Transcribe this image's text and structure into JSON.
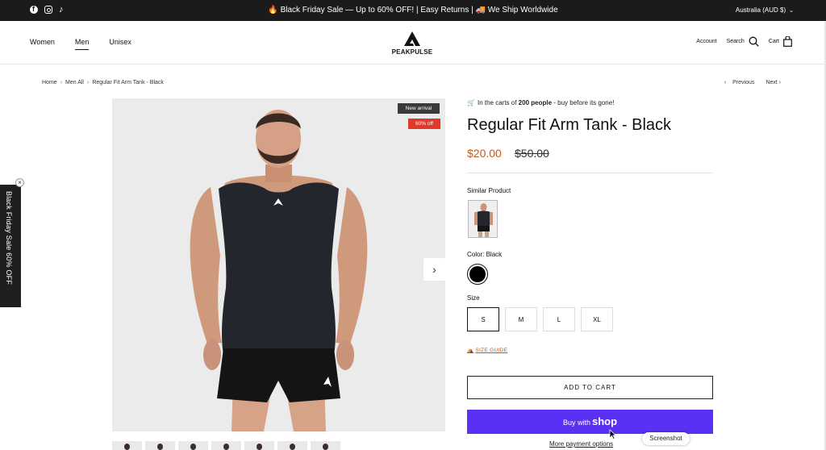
{
  "announcement": {
    "message": "🔥 Black Friday Sale — Up to 60% OFF! | Easy Returns | 🚚 We Ship Worldwide",
    "region": "Australia (AUD $)",
    "social": [
      "facebook-icon",
      "instagram-icon",
      "tiktok-icon"
    ]
  },
  "header": {
    "nav": [
      "Women",
      "Men",
      "Unisex"
    ],
    "active_nav": "Men",
    "brand": "PEAKPULSE",
    "account": "Account",
    "search": "Search",
    "cart": "Cart"
  },
  "breadcrumb": {
    "items": [
      "Home",
      "Men All",
      "Regular Fit Arm Tank - Black"
    ],
    "previous": "Previous",
    "next": "Next"
  },
  "gallery": {
    "badge_new": "New arrival",
    "badge_discount": "60% off",
    "thumbnail_count": 7
  },
  "side_tab": {
    "label": "Black Friday Sale 60% OFF",
    "close": "×"
  },
  "product": {
    "carts_prefix": "In the carts of",
    "carts_count": "200 people",
    "carts_suffix": "- buy before its gone!",
    "title": "Regular Fit Arm Tank - Black",
    "price": "$20.00",
    "compare_price": "$50.00",
    "similar_label": "Similar Product",
    "color_label": "Color:",
    "color_value": "Black",
    "size_label": "Size",
    "sizes": [
      "S",
      "M",
      "L",
      "XL"
    ],
    "selected_size": "S",
    "size_guide": "SIZE GUIDE",
    "add_to_cart": "ADD TO CART",
    "buy_with": "Buy with",
    "shop": "shop",
    "more_payment": "More payment options"
  },
  "toast": "Screenshot",
  "colors": {
    "announcement_bg": "#1b1b1b",
    "price": "#c15b12",
    "discount_badge": "#e3392d",
    "shop_pay": "#5a31f4"
  }
}
